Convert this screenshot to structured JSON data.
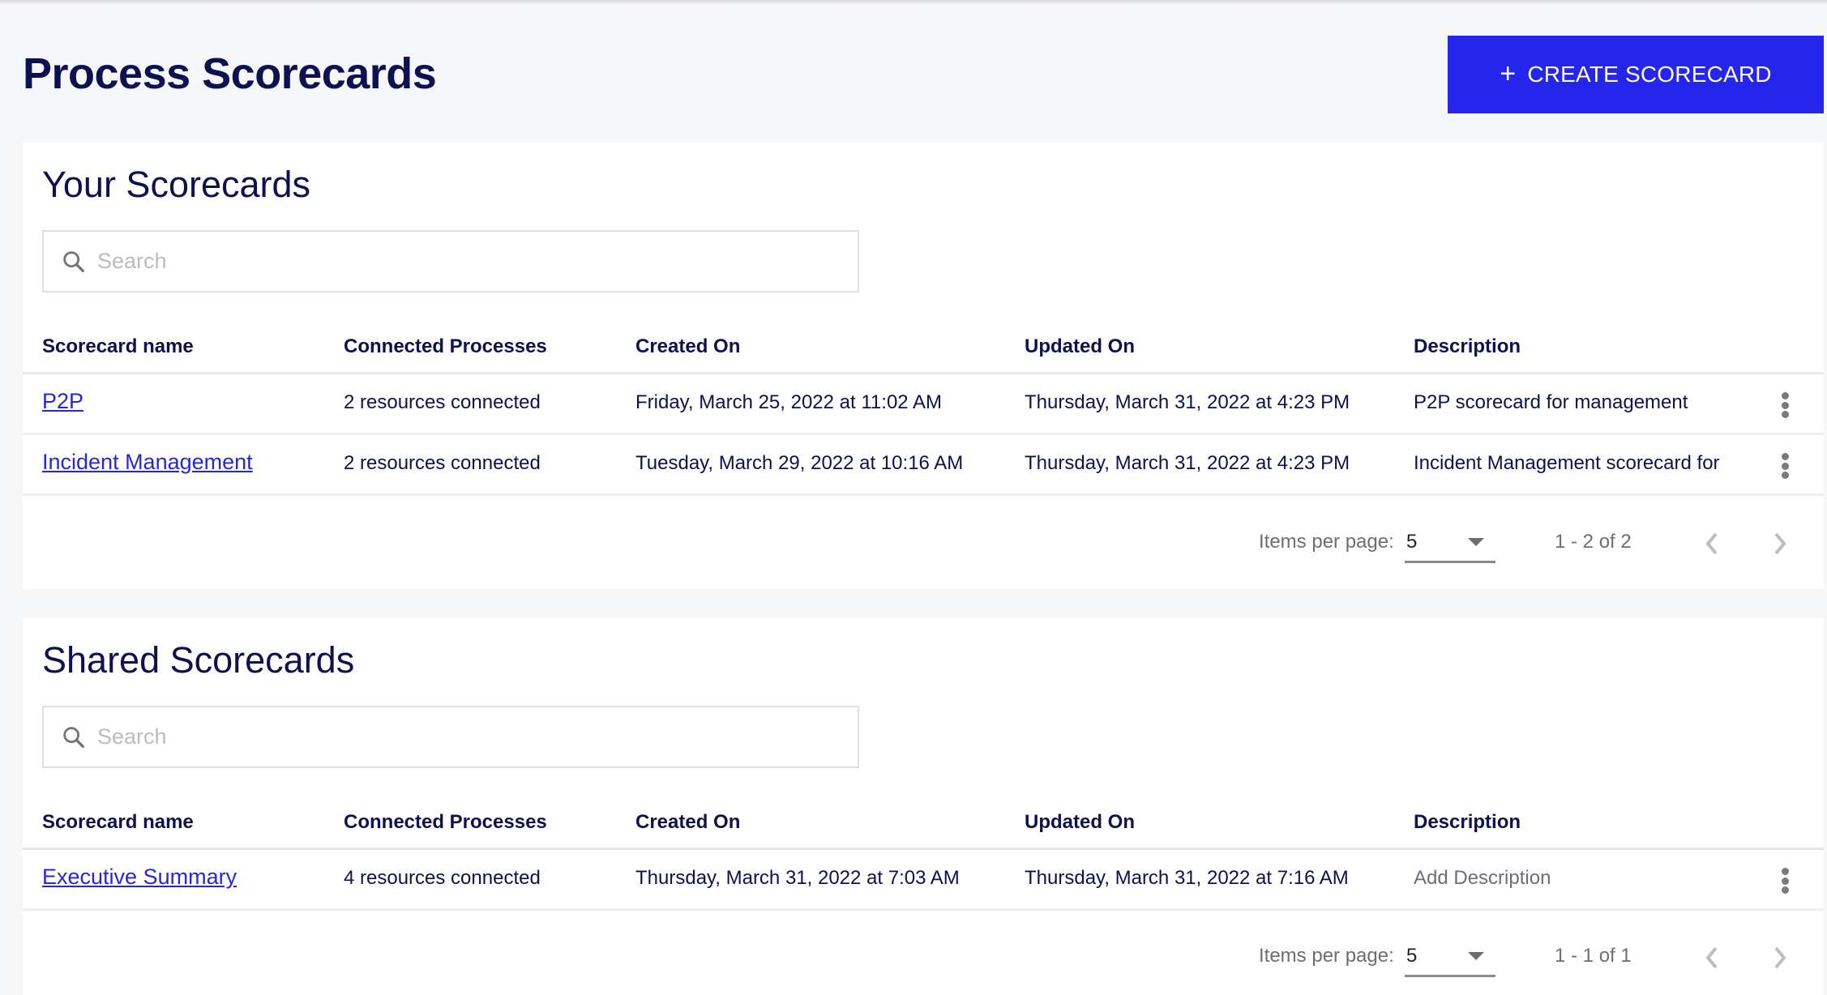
{
  "page": {
    "title": "Process Scorecards",
    "create_button": {
      "icon": "plus-icon",
      "label": "CREATE SCORECARD"
    }
  },
  "colors": {
    "primary": "#2525ee",
    "link": "#2626e0",
    "text": "#0d1150",
    "muted": "#6e6e6e"
  },
  "columns": [
    "Scorecard name",
    "Connected Processes",
    "Created On",
    "Updated On",
    "Description"
  ],
  "your_scorecards": {
    "title": "Your Scorecards",
    "search": {
      "placeholder": "Search",
      "value": ""
    },
    "rows": [
      {
        "name": "P2P",
        "connected": "2 resources connected",
        "created": "Friday, March 25, 2022 at 11:02 AM",
        "updated": "Thursday, March 31, 2022 at 4:23 PM",
        "description": "P2P scorecard for management"
      },
      {
        "name": "Incident Management",
        "connected": "2 resources connected",
        "created": "Tuesday, March 29, 2022 at 10:16 AM",
        "updated": "Thursday, March 31, 2022 at 4:23 PM",
        "description": "Incident Management scorecard for"
      }
    ],
    "pagination": {
      "items_per_page_label": "Items per page:",
      "items_per_page": "5",
      "range": "1 - 2 of 2"
    }
  },
  "shared_scorecards": {
    "title": "Shared Scorecards",
    "search": {
      "placeholder": "Search",
      "value": ""
    },
    "rows": [
      {
        "name": "Executive Summary",
        "connected": "4 resources connected",
        "created": "Thursday, March 31, 2022 at 7:03 AM",
        "updated": "Thursday, March 31, 2022 at 7:16 AM",
        "description": "Add Description"
      }
    ],
    "pagination": {
      "items_per_page_label": "Items per page:",
      "items_per_page": "5",
      "range": "1 - 1 of 1"
    }
  }
}
